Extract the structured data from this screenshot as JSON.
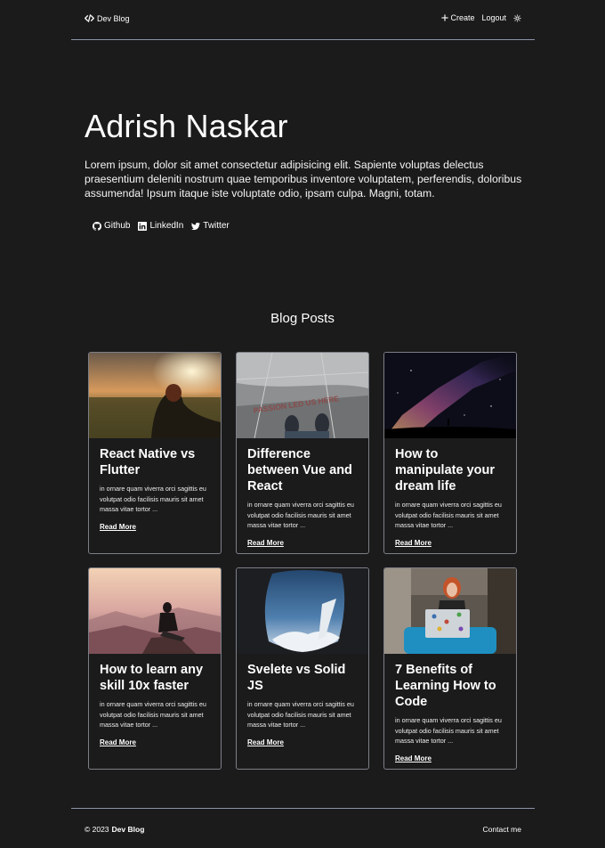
{
  "nav": {
    "brand": "Dev Blog",
    "create_label": "Create",
    "logout_label": "Logout"
  },
  "hero": {
    "name": "Adrish Naskar",
    "bio": "Lorem ipsum, dolor sit amet consectetur adipisicing elit. Sapiente voluptas delectus praesentium deleniti nostrum quae temporibus inventore voluptatem, perferendis, doloribus assumenda! Ipsum itaque iste voluptate odio, ipsam culpa. Magni, totam.",
    "socials": [
      {
        "label": "Github",
        "icon": "github-icon"
      },
      {
        "label": "LinkedIn",
        "icon": "linkedin-icon"
      },
      {
        "label": "Twitter",
        "icon": "twitter-icon"
      }
    ]
  },
  "posts": {
    "title": "Blog Posts",
    "read_more": "Read More",
    "items": [
      {
        "title": "React Native vs Flutter",
        "excerpt": "in ornare quam viverra orci sagittis eu volutpat odio facilisis mauris sit amet massa vitae tortor ..."
      },
      {
        "title": "Difference between Vue and React",
        "excerpt": "in ornare quam viverra orci sagittis eu volutpat odio facilisis mauris sit amet massa vitae tortor ..."
      },
      {
        "title": "How to manipulate your dream life",
        "excerpt": "in ornare quam viverra orci sagittis eu volutpat odio facilisis mauris sit amet massa vitae tortor ..."
      },
      {
        "title": "How to learn any skill 10x faster",
        "excerpt": "in ornare quam viverra orci sagittis eu volutpat odio facilisis mauris sit amet massa vitae tortor ..."
      },
      {
        "title": "Svelete vs Solid JS",
        "excerpt": "in ornare quam viverra orci sagittis eu volutpat odio facilisis mauris sit amet massa vitae tortor ..."
      },
      {
        "title": "7 Benefits of Learning How to Code",
        "excerpt": "in ornare quam viverra orci sagittis eu volutpat odio facilisis mauris sit amet massa vitae tortor ..."
      }
    ]
  },
  "footer": {
    "copyright": "© 2023",
    "brand": "Dev Blog",
    "contact_label": "Contact me"
  },
  "colors": {
    "background": "#1b1b1c",
    "divider": "#8a93a8",
    "card_border": "#7c7f86"
  }
}
